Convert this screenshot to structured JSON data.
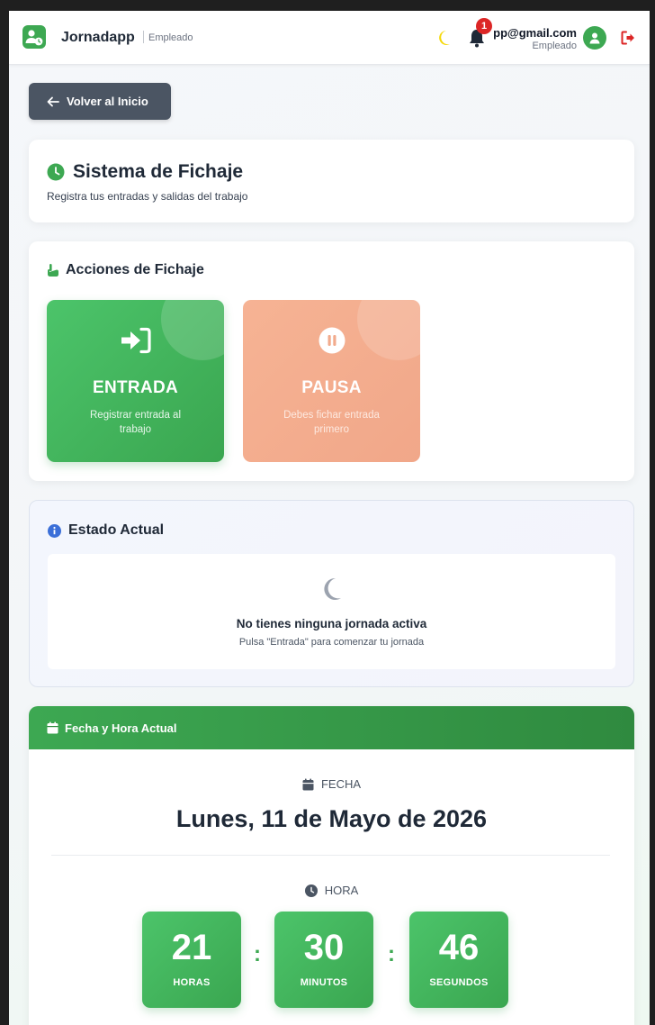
{
  "app": {
    "brand": "Jornadapp",
    "role_tag": "Empleado",
    "notifications_count": "1",
    "user_email": "pp@gmail.com",
    "user_role": "Empleado"
  },
  "back_button": {
    "label": "Volver al Inicio"
  },
  "header": {
    "title": "Sistema de Fichaje",
    "subtitle": "Registra tus entradas y salidas del trabajo"
  },
  "actions": {
    "title": "Acciones de Fichaje",
    "entry": {
      "title": "ENTRADA",
      "description": "Registrar entrada al trabajo"
    },
    "pause": {
      "title": "PAUSA",
      "description": "Debes fichar entrada primero"
    }
  },
  "status": {
    "title": "Estado Actual",
    "message": "No tienes ninguna jornada activa",
    "hint": "Pulsa \"Entrada\" para comenzar tu jornada"
  },
  "datetime": {
    "title": "Fecha y Hora Actual",
    "date_label": "FECHA",
    "date_value": "Lunes, 11 de Mayo de 2026",
    "time_label": "HORA",
    "hours": "21",
    "hours_label": "HORAS",
    "minutes": "30",
    "minutes_label": "MINUTOS",
    "seconds": "46",
    "seconds_label": "SEGUNDOS",
    "separator": ":"
  },
  "colors": {
    "brand_green": "#3da852",
    "pause_orange": "#f1a789",
    "danger_red": "#dc2626",
    "back_gray": "#4b5563",
    "info_blue": "#3b6fd8"
  },
  "icons": {
    "logo": "user-clock-icon",
    "theme": "moon-icon",
    "notifications": "bell-icon",
    "avatar": "user-icon",
    "logout": "logout-icon",
    "back": "arrow-left-icon",
    "title": "clock-icon",
    "actions": "hand-pointer-icon",
    "entry": "sign-in-icon",
    "pause": "pause-circle-icon",
    "status": "info-circle-icon",
    "status_empty": "moon-icon",
    "datetime": "calendar-icon",
    "time": "clock-icon"
  }
}
